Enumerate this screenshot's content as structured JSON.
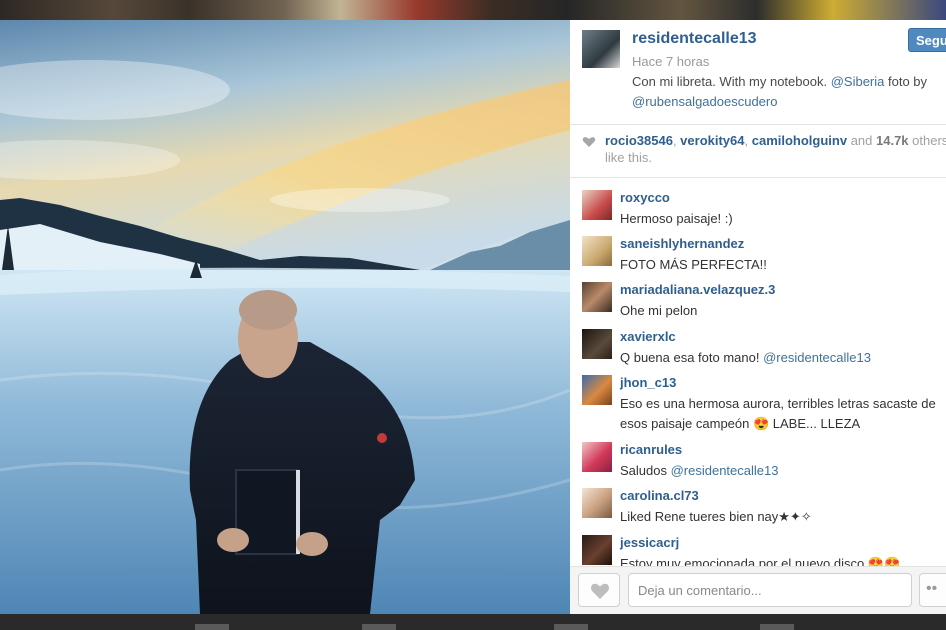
{
  "post": {
    "username": "residentecalle13",
    "time": "Hace 7 horas",
    "follow_label": "Segu",
    "caption_part1": "Con mi libreta. With my notebook. ",
    "caption_mention1": "@Siberia",
    "caption_part2": " foto by ",
    "caption_mention2": "@rubensalgadoescudero"
  },
  "likes": {
    "user1": "rocio38546",
    "sep1": ", ",
    "user2": "verokity64",
    "sep2": ", ",
    "user3": "camiloholguinv",
    "and_text": " and ",
    "count": "14.7k",
    "rest": " others like this."
  },
  "comments": [
    {
      "user": "roxycco",
      "text": "Hermoso paisaje! :)"
    },
    {
      "user": "saneishlyhernandez",
      "text": "FOTO MÁS PERFECTA!!"
    },
    {
      "user": "mariadaliana.velazquez.3",
      "text": "Ohe mi pelon"
    },
    {
      "user": "xavierxlc",
      "text": "Q buena esa foto mano! ",
      "mention": "@residentecalle13"
    },
    {
      "user": "jhon_c13",
      "text": "Eso es una hermosa aurora, terribles letras sacaste de esos paisaje campeón 😍 LABE... LLEZA"
    },
    {
      "user": "ricanrules",
      "text": "Saludos ",
      "mention": "@residentecalle13"
    },
    {
      "user": "carolina.cl73",
      "text": "Liked Rene tueres bien nay★✦✧"
    },
    {
      "user": "jessicacrj",
      "text": "Estoy muy emocionada por el nuevo disco 😍😍"
    }
  ],
  "footer": {
    "comment_placeholder": "Deja un comentario...",
    "more_label": "••"
  },
  "icons": {
    "like": "heart-icon",
    "likes_indicator": "heart-icon",
    "more": "ellipsis-icon"
  },
  "colors": {
    "username": "#2f5f8f",
    "link": "#3f729b",
    "follow_button": "#4e8ac0"
  }
}
